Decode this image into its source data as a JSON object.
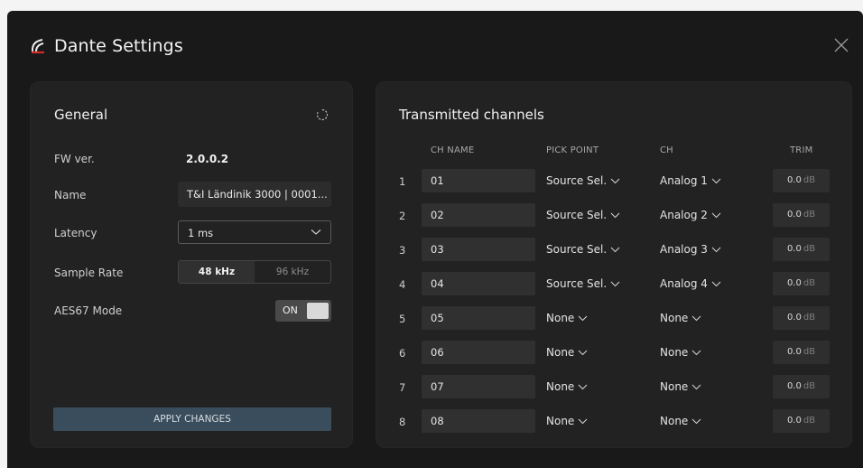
{
  "window": {
    "title": "Dante Settings"
  },
  "general": {
    "title": "General",
    "fw_label": "FW ver.",
    "fw_value": "2.0.0.2",
    "name_label": "Name",
    "name_value": "T&I Ländinik 3000 | 0001...",
    "latency_label": "Latency",
    "latency_value": "1 ms",
    "sample_rate_label": "Sample Rate",
    "sample_rate_options": [
      "48 kHz",
      "96 kHz"
    ],
    "sample_rate_selected": "48 kHz",
    "aes67_label": "AES67 Mode",
    "aes67_state": "ON",
    "apply_label": "APPLY CHANGES"
  },
  "channels": {
    "title": "Transmitted channels",
    "headers": {
      "name": "CH NAME",
      "pick": "PICK POINT",
      "ch": "CH",
      "trim": "TRIM"
    },
    "rows": [
      {
        "num": "1",
        "name": "01",
        "pick": "Source Sel.",
        "ch": "Analog 1",
        "trim": "0.0",
        "unit": "dB"
      },
      {
        "num": "2",
        "name": "02",
        "pick": "Source Sel.",
        "ch": "Analog 2",
        "trim": "0.0",
        "unit": "dB"
      },
      {
        "num": "3",
        "name": "03",
        "pick": "Source Sel.",
        "ch": "Analog 3",
        "trim": "0.0",
        "unit": "dB"
      },
      {
        "num": "4",
        "name": "04",
        "pick": "Source Sel.",
        "ch": "Analog 4",
        "trim": "0.0",
        "unit": "dB"
      },
      {
        "num": "5",
        "name": "05",
        "pick": "None",
        "ch": "None",
        "trim": "0.0",
        "unit": "dB"
      },
      {
        "num": "6",
        "name": "06",
        "pick": "None",
        "ch": "None",
        "trim": "0.0",
        "unit": "dB"
      },
      {
        "num": "7",
        "name": "07",
        "pick": "None",
        "ch": "None",
        "trim": "0.0",
        "unit": "dB"
      },
      {
        "num": "8",
        "name": "08",
        "pick": "None",
        "ch": "None",
        "trim": "0.0",
        "unit": "dB"
      }
    ]
  },
  "colors": {
    "background": "#191919",
    "panel": "#222222",
    "accent_logo": "#d12b2b",
    "apply_button": "#3a4d5c"
  },
  "icons": {
    "logo": "dante-logo-icon",
    "close": "close-icon",
    "refresh": "refresh-icon",
    "dropdown": "chevron-down-icon"
  }
}
